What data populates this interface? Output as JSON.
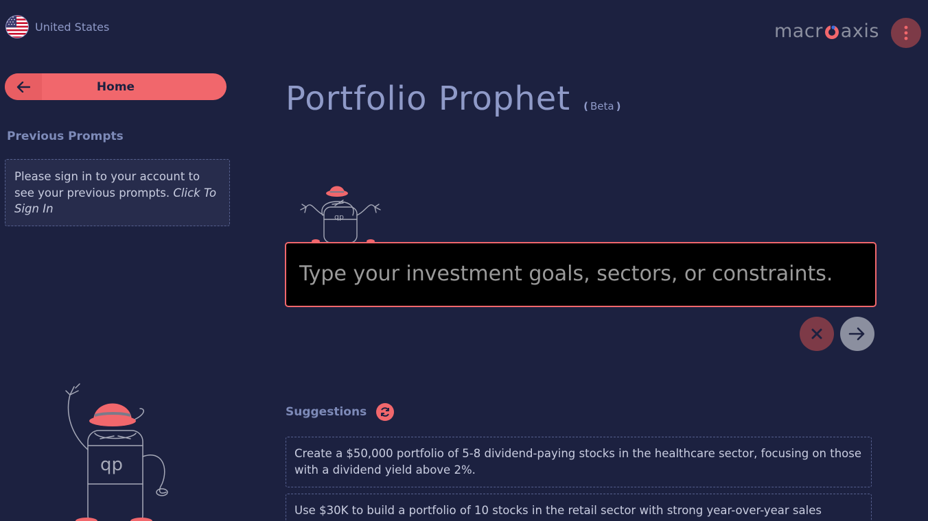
{
  "header": {
    "country": "United States",
    "logo": {
      "left": "macr",
      "right": "axis"
    },
    "menu_icon": "kebab-menu-icon"
  },
  "sidebar": {
    "home_label": "Home",
    "previous_prompts_title": "Previous Prompts",
    "signin_text": "Please sign in to your account to see your previous prompts.",
    "signin_link": "Click To Sign In"
  },
  "main": {
    "title": "Portfolio Prophet",
    "beta": "Beta",
    "prompt_placeholder": "Type your investment goals, sectors, or constraints.",
    "suggestions_title": "Suggestions",
    "suggestions": [
      "Create a $50,000 portfolio of 5-8 dividend-paying stocks in the healthcare sector, focusing on those with a dividend yield above 2%.",
      "Use $30K to build a portfolio of 10 stocks in the retail sector with strong year-over-year sales"
    ]
  },
  "colors": {
    "background": "#1c2140",
    "accent": "#f1676c",
    "muted_text": "#8f9ac8",
    "dark_red": "#7d3a47"
  }
}
